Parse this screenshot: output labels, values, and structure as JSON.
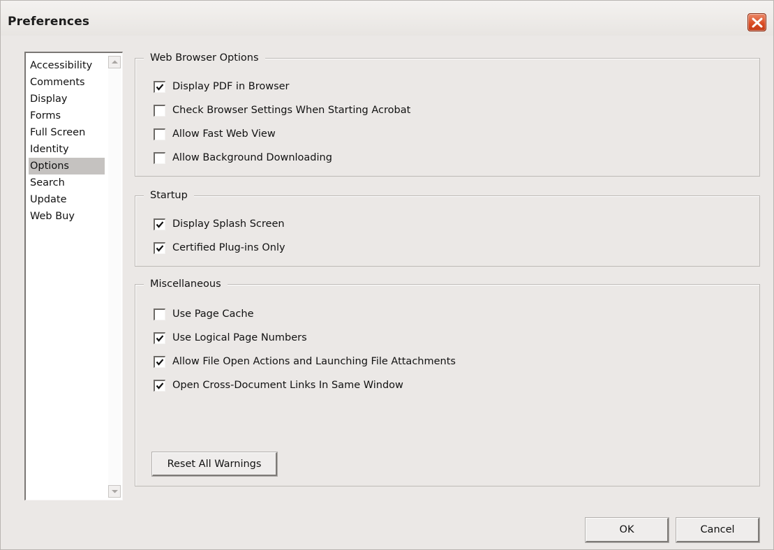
{
  "window": {
    "title": "Preferences",
    "close_icon": "close-icon"
  },
  "categories": [
    {
      "label": "Accessibility",
      "selected": false
    },
    {
      "label": "Comments",
      "selected": false
    },
    {
      "label": "Display",
      "selected": false
    },
    {
      "label": "Forms",
      "selected": false
    },
    {
      "label": "Full Screen",
      "selected": false
    },
    {
      "label": "Identity",
      "selected": false
    },
    {
      "label": "Options",
      "selected": true
    },
    {
      "label": "Search",
      "selected": false
    },
    {
      "label": "Update",
      "selected": false
    },
    {
      "label": "Web Buy",
      "selected": false
    }
  ],
  "groups": {
    "web_browser": {
      "title": "Web Browser Options",
      "options": [
        {
          "label": "Display PDF in Browser",
          "checked": true
        },
        {
          "label": "Check Browser Settings When Starting Acrobat",
          "checked": false
        },
        {
          "label": "Allow Fast Web View",
          "checked": false
        },
        {
          "label": "Allow Background Downloading",
          "checked": false
        }
      ]
    },
    "startup": {
      "title": "Startup",
      "options": [
        {
          "label": "Display Splash Screen",
          "checked": true
        },
        {
          "label": "Certified Plug-ins Only",
          "checked": true
        }
      ]
    },
    "misc": {
      "title": "Miscellaneous",
      "options": [
        {
          "label": "Use Page Cache",
          "checked": false
        },
        {
          "label": "Use Logical Page Numbers",
          "checked": true
        },
        {
          "label": "Allow File Open Actions and Launching File Attachments",
          "checked": true
        },
        {
          "label": "Open Cross-Document Links In Same Window",
          "checked": true
        }
      ],
      "reset_button": "Reset All Warnings"
    }
  },
  "footer": {
    "ok_label": "OK",
    "cancel_label": "Cancel"
  },
  "colors": {
    "close_button": "#d94a22",
    "selection": "#c5c2c0",
    "window_bg": "#ebe8e6"
  }
}
